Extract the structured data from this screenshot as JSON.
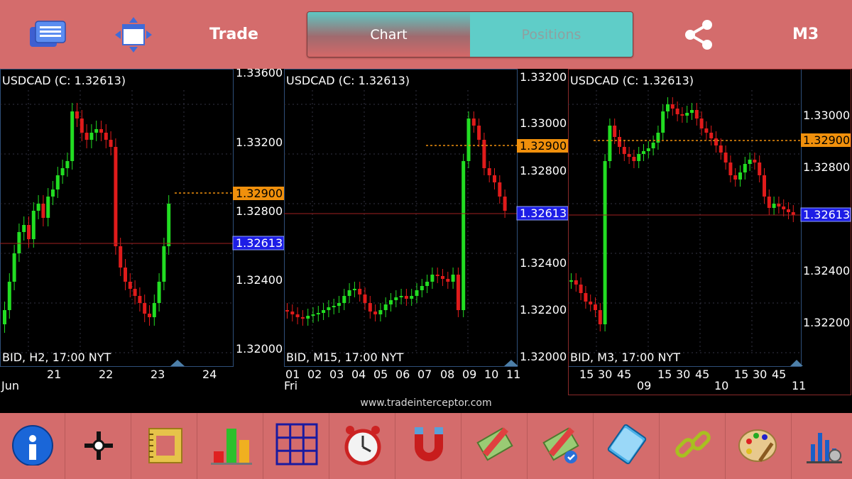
{
  "topbar": {
    "trade_label": "Trade",
    "tabs": [
      {
        "label": "Chart",
        "selected": true
      },
      {
        "label": "Positions",
        "selected": false
      }
    ],
    "timeframe": "M3"
  },
  "colors": {
    "bar": "#d46c6c",
    "bull": "#22dd22",
    "bear": "#e01b1b",
    "price_tag": "#f0900c",
    "bid_tag": "#1d1de6",
    "tab": "#5fcdc8"
  },
  "charts": [
    {
      "title": "USDCAD (C: 1.32613)",
      "info": "BID, H2, 17:00 NYT",
      "price_labels": [
        "1.33600",
        "1.33200",
        "1.32800",
        "1.32400",
        "1.32000"
      ],
      "order_tag": "1.32900",
      "bid_tag": "1.32613",
      "time_labels": [
        "21",
        "22",
        "23",
        "24"
      ],
      "month_label": "Jun"
    },
    {
      "title": "USDCAD (C: 1.32613)",
      "info": "BID, M15, 17:00 NYT",
      "price_labels": [
        "1.33200",
        "1.33000",
        "1.32800",
        "1.32400",
        "1.32200",
        "1.32000"
      ],
      "order_tag": "1.32900",
      "bid_tag": "1.32613",
      "time_labels": [
        "01",
        "02",
        "03",
        "04",
        "05",
        "06",
        "07",
        "08",
        "09",
        "10",
        "11"
      ],
      "day_label": "Fri"
    },
    {
      "title": "USDCAD (C: 1.32613)",
      "info": "BID, M3, 17:00 NYT",
      "price_labels": [
        "1.33000",
        "1.32800",
        "1.32400",
        "1.32200"
      ],
      "order_tag": "1.32900",
      "bid_tag": "1.32613",
      "time_labels": [
        "15",
        "30",
        "45",
        "15",
        "30",
        "45",
        "15",
        "30",
        "45"
      ],
      "time_sub_labels": [
        "09",
        "10",
        "11"
      ]
    }
  ],
  "footer_url": "www.tradeinterceptor.com",
  "toolbar_icons": [
    "info-icon",
    "crosshair-icon",
    "ruler-icon",
    "indicators-icon",
    "grid-icon",
    "alarm-clock-icon",
    "magnet-icon",
    "pencil-money-icon",
    "pencil-money-check-icon",
    "folders-icon",
    "link-icon",
    "palette-icon",
    "chart-settings-icon"
  ]
}
